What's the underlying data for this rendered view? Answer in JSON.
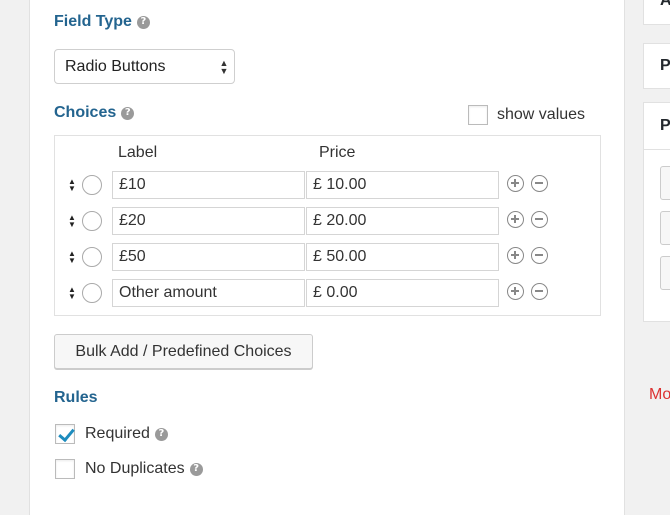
{
  "field_type": {
    "label": "Field Type",
    "help_glyph": "?",
    "selected_value": "Radio Buttons",
    "select_arrows": "▲\n▼"
  },
  "choices": {
    "label": "Choices",
    "help_glyph": "?",
    "show_values_label": "show values",
    "show_values_checked": false,
    "columns": {
      "label": "Label",
      "price": "Price"
    },
    "rows": [
      {
        "label": "£10",
        "price": "£ 10.00"
      },
      {
        "label": "£20",
        "price": "£ 20.00"
      },
      {
        "label": "£50",
        "price": "£ 50.00"
      },
      {
        "label": "Other amount",
        "price": "£ 0.00"
      }
    ]
  },
  "bulk_button_label": "Bulk Add / Predefined Choices",
  "rules": {
    "label": "Rules",
    "items": [
      {
        "label": "Required",
        "checked": true,
        "help_glyph": "?"
      },
      {
        "label": "No Duplicates",
        "checked": false,
        "help_glyph": "?"
      }
    ]
  },
  "sidebar": {
    "card_letters": [
      "A",
      "P",
      "P"
    ],
    "red_text": "Mo"
  },
  "colors": {
    "section_heading": "#23648f",
    "check_accent": "#1e8cbe",
    "sidebar_red": "#dc3232"
  },
  "icons": {
    "sort": "sort-arrows-icon",
    "radio": "radio-circle-icon",
    "add": "plus-circle-icon",
    "remove": "minus-circle-icon",
    "help": "question-mark-icon"
  }
}
